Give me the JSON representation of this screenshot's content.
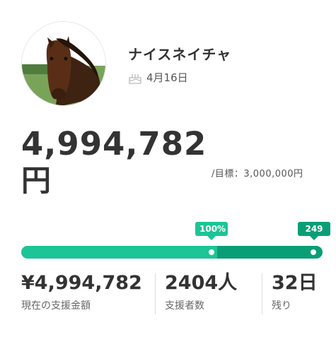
{
  "profile": {
    "name": "ナイスネイチャ",
    "birthday": "4月16日",
    "avatar": "horse-photo"
  },
  "funding": {
    "amount": "4,994,782",
    "unit": "円",
    "target": "/目標：3,000,000円"
  },
  "progress": {
    "percent_label": "100%",
    "stretch_label": "249",
    "first_segment_fraction": 0.65,
    "colors": {
      "primary": "#1dc496",
      "secondary": "#0a9e76"
    }
  },
  "stats": [
    {
      "value": "¥4,994,782",
      "label": "現在の支援金額"
    },
    {
      "value": "2404人",
      "label": "支援者数"
    },
    {
      "value": "32日",
      "label": "残り"
    }
  ]
}
